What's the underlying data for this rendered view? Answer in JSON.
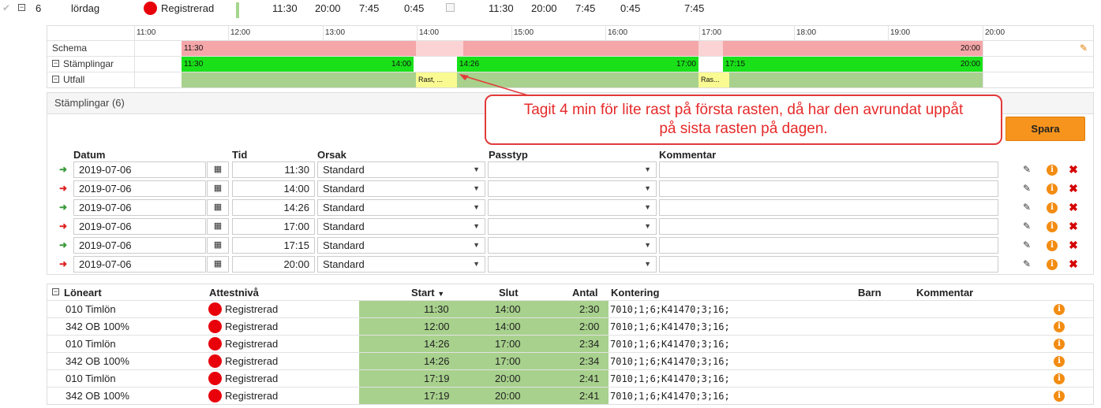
{
  "day_row": {
    "week": "6",
    "day": "lördag",
    "status": "Registrerad",
    "t1": "11:30",
    "t2": "20:00",
    "t3": "7:45",
    "t4": "0:45",
    "t5": "11:30",
    "t6": "20:00",
    "t7": "7:45",
    "t8": "0:45",
    "t9": "7:45"
  },
  "timeline": {
    "hours": [
      "11:00",
      "12:00",
      "13:00",
      "14:00",
      "15:00",
      "16:00",
      "17:00",
      "18:00",
      "19:00",
      "20:00"
    ],
    "rows": {
      "schema": "Schema",
      "stamplingar": "Stämplingar",
      "utfall": "Utfall"
    },
    "schema_start": "11:30",
    "schema_end": "20:00",
    "stamp_segments": [
      {
        "start": "11:30",
        "end": "14:00"
      },
      {
        "start": "14:26",
        "end": "17:00"
      },
      {
        "start": "17:15",
        "end": "20:00"
      }
    ],
    "utfall_breaks": [
      "Rast, ...",
      "Ras..."
    ]
  },
  "callout": {
    "line1": "Tagit 4 min för lite rast på första rasten, då har den avrundat uppåt",
    "line2": "på sista rasten på dagen."
  },
  "stamp_panel": {
    "title": "Stämplingar (6)",
    "save_label": "Spara",
    "headers": {
      "datum": "Datum",
      "tid": "Tid",
      "orsak": "Orsak",
      "passtyp": "Passtyp",
      "kommentar": "Kommentar"
    },
    "rows": [
      {
        "dir": "in",
        "date": "2019-07-06",
        "time": "11:30",
        "reason": "Standard",
        "passtyp": "",
        "comment": ""
      },
      {
        "dir": "out",
        "date": "2019-07-06",
        "time": "14:00",
        "reason": "Standard",
        "passtyp": "",
        "comment": ""
      },
      {
        "dir": "in",
        "date": "2019-07-06",
        "time": "14:26",
        "reason": "Standard",
        "passtyp": "",
        "comment": ""
      },
      {
        "dir": "out",
        "date": "2019-07-06",
        "time": "17:00",
        "reason": "Standard",
        "passtyp": "",
        "comment": ""
      },
      {
        "dir": "in",
        "date": "2019-07-06",
        "time": "17:15",
        "reason": "Standard",
        "passtyp": "",
        "comment": ""
      },
      {
        "dir": "out",
        "date": "2019-07-06",
        "time": "20:00",
        "reason": "Standard",
        "passtyp": "",
        "comment": ""
      }
    ]
  },
  "lone_table": {
    "headers": {
      "loneart": "Löneart",
      "attestniva": "Attestnivå",
      "start": "Start",
      "slut": "Slut",
      "antal": "Antal",
      "kontering": "Kontering",
      "barn": "Barn",
      "kommentar": "Kommentar"
    },
    "rows": [
      {
        "type": "010 Timlön",
        "status": "Registrerad",
        "start": "11:30",
        "end": "14:00",
        "count": "2:30",
        "kontering": "7010;1;6;K41470;3;16;"
      },
      {
        "type": "342 OB 100%",
        "status": "Registrerad",
        "start": "12:00",
        "end": "14:00",
        "count": "2:00",
        "kontering": "7010;1;6;K41470;3;16;"
      },
      {
        "type": "010 Timlön",
        "status": "Registrerad",
        "start": "14:26",
        "end": "17:00",
        "count": "2:34",
        "kontering": "7010;1;6;K41470;3;16;"
      },
      {
        "type": "342 OB 100%",
        "status": "Registrerad",
        "start": "14:26",
        "end": "17:00",
        "count": "2:34",
        "kontering": "7010;1;6;K41470;3;16;"
      },
      {
        "type": "010 Timlön",
        "status": "Registrerad",
        "start": "17:19",
        "end": "20:00",
        "count": "2:41",
        "kontering": "7010;1;6;K41470;3;16;"
      },
      {
        "type": "342 OB 100%",
        "status": "Registrerad",
        "start": "17:19",
        "end": "20:00",
        "count": "2:41",
        "kontering": "7010;1;6;K41470;3;16;"
      }
    ]
  },
  "icons": {
    "edit": "edit-icon",
    "info": "info-icon",
    "delete": "delete-icon",
    "calendar": "calendar-icon",
    "pencil": "pencil-icon",
    "in": "arrow-in-icon",
    "out": "arrow-out-icon"
  },
  "colors": {
    "schema": "#f4a6a8",
    "stamp": "#19e019",
    "utfall": "#a8d18d",
    "break": "#fafa93",
    "status_red": "#e8000b",
    "save": "#f7941d"
  }
}
